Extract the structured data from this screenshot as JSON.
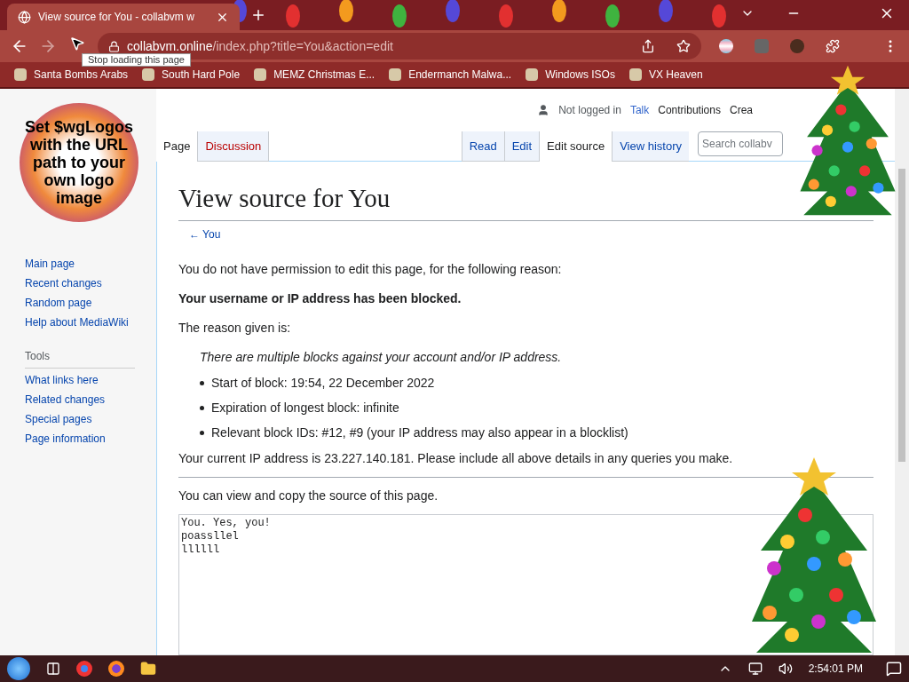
{
  "browser": {
    "tab": {
      "title": "View source for You - collabvm w",
      "selected": true
    },
    "url": {
      "host": "collabvm.online",
      "path": "/index.php?title=You&action=edit"
    },
    "tooltip": "Stop loading this page",
    "bookmarks": [
      "Santa Bombs Arabs",
      "South Hard Pole",
      "MEMZ Christmas E...",
      "Endermanch Malwa...",
      "Windows ISOs",
      "VX Heaven"
    ]
  },
  "personal_tools": {
    "status": "Not logged in",
    "links": [
      "Talk",
      "Contributions",
      "Crea"
    ]
  },
  "logo": {
    "text": "Set $wgLogos with the URL path to your own logo image"
  },
  "sidebar": {
    "navigation": [
      "Main page",
      "Recent changes",
      "Random page",
      "Help about MediaWiki"
    ],
    "tools": {
      "heading": "Tools",
      "items": [
        "What links here",
        "Related changes",
        "Special pages",
        "Page information"
      ]
    }
  },
  "tabs_left": [
    {
      "label": "Page",
      "selected": true,
      "missing": false
    },
    {
      "label": "Discussion",
      "selected": false,
      "missing": true
    }
  ],
  "tabs_right": [
    {
      "label": "Read",
      "selected": false
    },
    {
      "label": "Edit",
      "selected": false
    },
    {
      "label": "Edit source",
      "selected": true
    },
    {
      "label": "View history",
      "selected": false
    }
  ],
  "search": {
    "placeholder": "Search collabv"
  },
  "page": {
    "title": "View source for You",
    "backlink": "← You",
    "intro": "You do not have permission to edit this page, for the following reason:",
    "blocked": "Your username or IP address has been blocked.",
    "reason_label": "The reason given is:",
    "reason": "There are multiple blocks against your account and/or IP address.",
    "details": [
      "Start of block: 19:54, 22 December 2022",
      "Expiration of longest block: infinite",
      "Relevant block IDs: #12, #9 (your IP address may also appear in a blocklist)"
    ],
    "ip_note": "Your current IP address is 23.227.140.181. Please include all above details in any queries you make.",
    "source_note": "You can view and copy the source of this page.",
    "source": "You. Yes, you!\npoassllel\nllllll"
  },
  "taskbar": {
    "time": "2:54:01 PM"
  }
}
